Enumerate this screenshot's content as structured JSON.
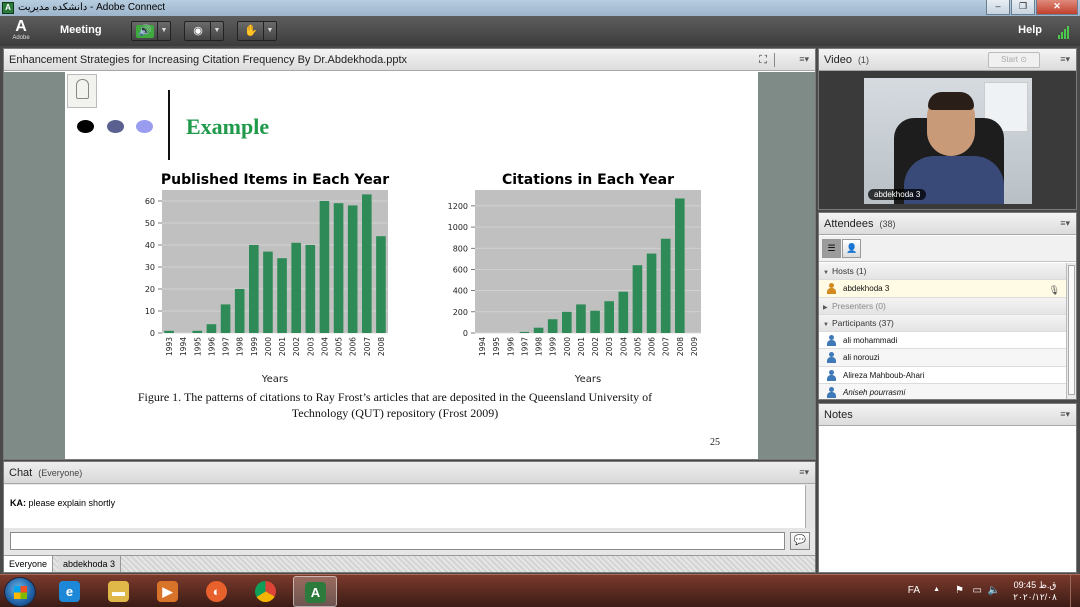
{
  "window": {
    "title": "دانشکده مدیریت - Adobe Connect",
    "controls": [
      "–",
      "❐",
      "✕"
    ]
  },
  "menubar": {
    "logo_text": "Adobe",
    "meeting_label": "Meeting",
    "help_label": "Help"
  },
  "share": {
    "title": "Enhancement Strategies for Increasing Citation Frequency By Dr.Abdekhoda.pptx",
    "menu_icon": "≡▾"
  },
  "slide": {
    "title": "Example",
    "caption_line1": "Figure 1. The patterns of citations to Ray Frost’s articles that are deposited in the Queensland University of",
    "caption_line2": "Technology (QUT) repository (Frost 2009)",
    "page_number": "25",
    "dot_colors": [
      "#000000",
      "#5a6090",
      "#9a9cf0"
    ]
  },
  "chart_data": [
    {
      "type": "bar",
      "title": "Published Items in Each Year",
      "xlabel": "Years",
      "ylabel": "",
      "ylim": [
        0,
        65
      ],
      "yticks": [
        0,
        10,
        20,
        30,
        40,
        50,
        60
      ],
      "categories": [
        "1993",
        "1994",
        "1995",
        "1996",
        "1997",
        "1998",
        "1999",
        "2000",
        "2001",
        "2002",
        "2003",
        "2004",
        "2005",
        "2006",
        "2007",
        "2008"
      ],
      "values": [
        1,
        0,
        1,
        4,
        13,
        20,
        40,
        37,
        34,
        41,
        40,
        60,
        59,
        58,
        63,
        44
      ],
      "bar_color": "#2e8b57",
      "background": "#c0c0c0",
      "grid": true
    },
    {
      "type": "bar",
      "title": "Citations in Each Year",
      "xlabel": "Years",
      "ylabel": "",
      "ylim": [
        0,
        1350
      ],
      "yticks": [
        0,
        200,
        400,
        600,
        800,
        1000,
        1200
      ],
      "categories": [
        "1994",
        "1995",
        "1996",
        "1997",
        "1998",
        "1999",
        "2000",
        "2001",
        "2002",
        "2003",
        "2004",
        "2005",
        "2006",
        "2007",
        "2008",
        "2009"
      ],
      "values": [
        0,
        0,
        0,
        10,
        50,
        130,
        200,
        270,
        210,
        300,
        390,
        640,
        750,
        890,
        1270,
        0
      ],
      "bar_color": "#2e8b57",
      "background": "#c0c0c0",
      "grid": true
    }
  ],
  "chat": {
    "title": "Chat",
    "scope": "(Everyone)",
    "messages": [
      {
        "sender": "KA:",
        "text": "please explain shortly"
      }
    ],
    "input_value": "",
    "tabs": [
      "Everyone",
      "abdekhoda 3"
    ]
  },
  "video": {
    "title": "Video",
    "count": "(1)",
    "start_label": "Start",
    "name_tag": "abdekhoda 3"
  },
  "attendees": {
    "title": "Attendees",
    "count": "(38)",
    "hosts_label": "Hosts (1)",
    "presenters_label": "Presenters (0)",
    "participants_label": "Participants (37)",
    "hosts": [
      "abdekhoda 3"
    ],
    "participants": [
      "ali mohammadi",
      "ali norouzi",
      "Alireza Mahboub-Ahari",
      "Aniseh pourrasmi"
    ]
  },
  "notes": {
    "title": "Notes"
  },
  "taskbar": {
    "language": "FA",
    "time": "09:45 ق.ظ",
    "date": "۲۰۲۰/۱۲/۰۸"
  }
}
